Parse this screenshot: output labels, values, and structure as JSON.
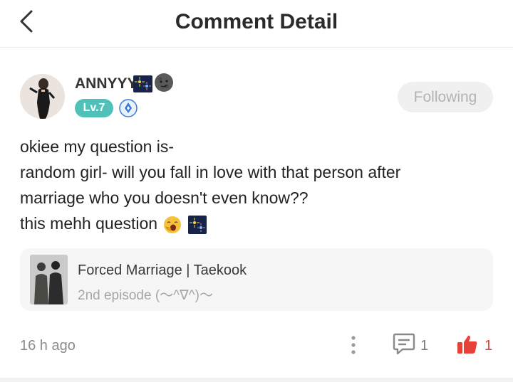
{
  "header": {
    "title": "Comment Detail",
    "back_icon": "chevron-left-icon"
  },
  "author": {
    "name": "ANNYYY",
    "level": "Lv.7",
    "level_color": "#4fc1b8",
    "follow_label": "Following",
    "name_emojis": [
      "fireworks-emoji-icon",
      "new-moon-face-emoji-icon"
    ],
    "badge_icon": "blue-rank-badge-icon"
  },
  "comment": {
    "lines": [
      "okiee my question is-",
      "random girl- will you fall in love with that person after",
      "marriage who you doesn't even know??",
      "this mehh question"
    ],
    "trailing_emojis": [
      "yawning-face-emoji-icon",
      "fireworks-emoji-icon"
    ]
  },
  "story": {
    "title": "Forced Marriage | Taekook",
    "episode": "2nd episode (〜^∇^)〜"
  },
  "footer": {
    "time": "16 h ago",
    "reply_count": "1",
    "like_count": "1",
    "like_color": "#e8413a"
  }
}
